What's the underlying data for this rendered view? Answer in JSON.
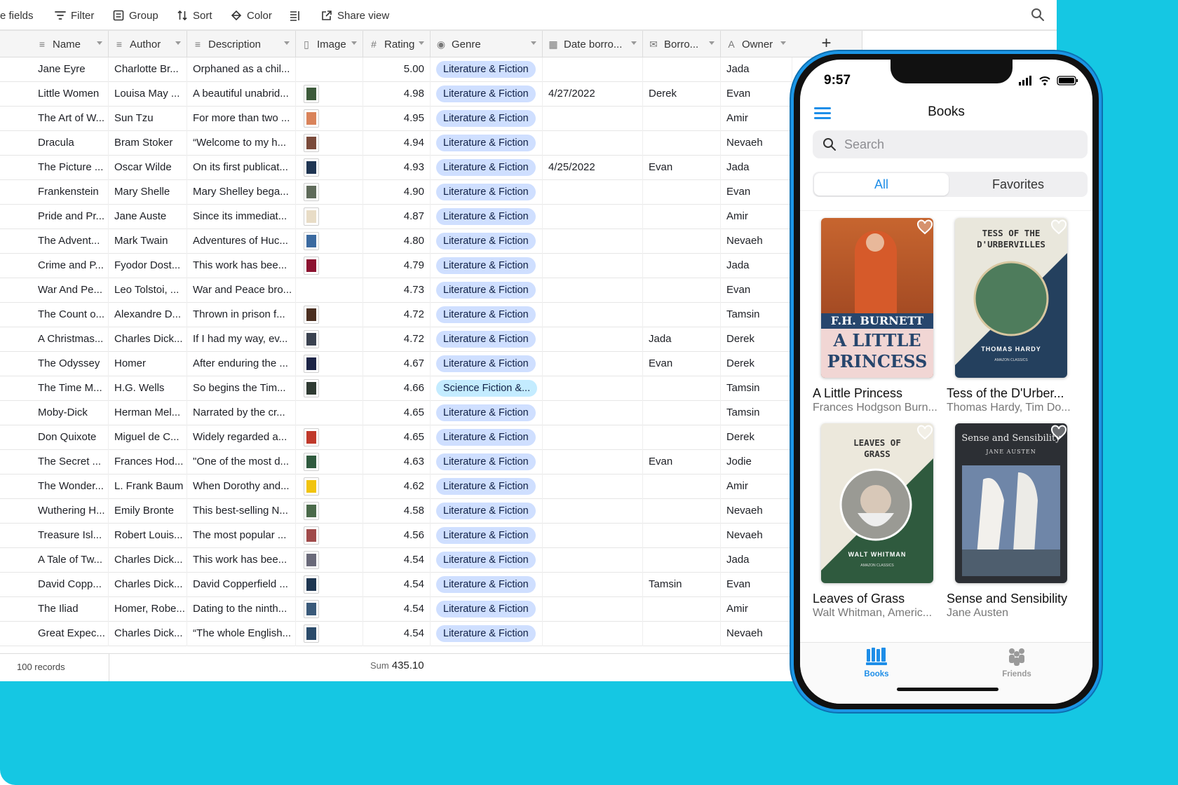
{
  "colors": {
    "teal": "#15c7e3",
    "pill": "#cfdfff",
    "pill_sci": "#c4ecff",
    "ios_blue": "#1e8ee8"
  },
  "toolbar": {
    "hide_fields": "e fields",
    "filter": "Filter",
    "group": "Group",
    "sort": "Sort",
    "color": "Color",
    "share": "Share view"
  },
  "columns": {
    "name": "Name",
    "author": "Author",
    "description": "Description",
    "image": "Image",
    "rating": "Rating",
    "genre": "Genre",
    "date": "Date borro...",
    "borrower": "Borro...",
    "owner": "Owner",
    "add": "+"
  },
  "rows": [
    {
      "name": "Jane Eyre",
      "author": "Charlotte Br...",
      "desc": "Orphaned as a chil...",
      "thumb": "",
      "rating": "5.00",
      "genre": "Literature & Fiction",
      "date": "",
      "borrower": "",
      "owner": "Jada"
    },
    {
      "name": "Little Women",
      "author": "Louisa May ...",
      "desc": "A beautiful unabrid...",
      "thumb": "#3c5a3a",
      "rating": "4.98",
      "genre": "Literature & Fiction",
      "date": "4/27/2022",
      "borrower": "Derek",
      "owner": "Evan"
    },
    {
      "name": "The Art of W...",
      "author": "Sun Tzu",
      "desc": "For more than two ...",
      "thumb": "#d9835a",
      "rating": "4.95",
      "genre": "Literature & Fiction",
      "date": "",
      "borrower": "",
      "owner": "Amir"
    },
    {
      "name": "Dracula",
      "author": "Bram Stoker",
      "desc": "“Welcome to my h...",
      "thumb": "#7a4a3a",
      "rating": "4.94",
      "genre": "Literature & Fiction",
      "date": "",
      "borrower": "",
      "owner": "Nevaeh"
    },
    {
      "name": "The Picture ...",
      "author": "Oscar Wilde",
      "desc": "On its first publicat...",
      "thumb": "#1f3552",
      "rating": "4.93",
      "genre": "Literature & Fiction",
      "date": "4/25/2022",
      "borrower": "Evan",
      "owner": "Jada"
    },
    {
      "name": "Frankenstein",
      "author": "Mary Shelle",
      "desc": "Mary Shelley bega...",
      "thumb": "#5f6b5a",
      "rating": "4.90",
      "genre": "Literature & Fiction",
      "date": "",
      "borrower": "",
      "owner": "Evan"
    },
    {
      "name": "Pride and Pr...",
      "author": "Jane Auste",
      "desc": "Since its immediat...",
      "thumb": "#e8dcc6",
      "rating": "4.87",
      "genre": "Literature & Fiction",
      "date": "",
      "borrower": "",
      "owner": "Amir"
    },
    {
      "name": "The Advent...",
      "author": "Mark Twain",
      "desc": "Adventures of Huc...",
      "thumb": "#3b6aa0",
      "rating": "4.80",
      "genre": "Literature & Fiction",
      "date": "",
      "borrower": "",
      "owner": "Nevaeh"
    },
    {
      "name": "Crime and P...",
      "author": "Fyodor Dost...",
      "desc": "This work has bee...",
      "thumb": "#8c1230",
      "rating": "4.79",
      "genre": "Literature & Fiction",
      "date": "",
      "borrower": "",
      "owner": "Jada"
    },
    {
      "name": "War And Pe...",
      "author": "Leo Tolstoi, ...",
      "desc": "War and Peace bro...",
      "thumb": "",
      "rating": "4.73",
      "genre": "Literature & Fiction",
      "date": "",
      "borrower": "",
      "owner": "Evan"
    },
    {
      "name": "The Count o...",
      "author": "Alexandre D...",
      "desc": "Thrown in prison f...",
      "thumb": "#4a2e20",
      "rating": "4.72",
      "genre": "Literature & Fiction",
      "date": "",
      "borrower": "",
      "owner": "Tamsin"
    },
    {
      "name": "A Christmas...",
      "author": "Charles Dick...",
      "desc": "If I had my way, ev...",
      "thumb": "#3a4250",
      "rating": "4.72",
      "genre": "Literature & Fiction",
      "date": "",
      "borrower": "Jada",
      "owner": "Derek"
    },
    {
      "name": "The Odyssey",
      "author": "Homer",
      "desc": "After enduring the ...",
      "thumb": "#1c2446",
      "rating": "4.67",
      "genre": "Literature & Fiction",
      "date": "",
      "borrower": "Evan",
      "owner": "Derek"
    },
    {
      "name": "The Time M...",
      "author": "H.G. Wells",
      "desc": "So begins the Tim...",
      "thumb": "#2e3a32",
      "rating": "4.66",
      "genre": "Science Fiction &...",
      "date": "",
      "borrower": "",
      "owner": "Tamsin"
    },
    {
      "name": "Moby-Dick",
      "author": "Herman Mel...",
      "desc": "Narrated by the cr...",
      "thumb": "",
      "rating": "4.65",
      "genre": "Literature & Fiction",
      "date": "",
      "borrower": "",
      "owner": "Tamsin"
    },
    {
      "name": "Don Quixote",
      "author": "Miguel de C...",
      "desc": "Widely regarded a...",
      "thumb": "#c0392b",
      "rating": "4.65",
      "genre": "Literature & Fiction",
      "date": "",
      "borrower": "",
      "owner": "Derek"
    },
    {
      "name": "The Secret ...",
      "author": "Frances Hod...",
      "desc": "\"One of the most d...",
      "thumb": "#2f5a3e",
      "rating": "4.63",
      "genre": "Literature & Fiction",
      "date": "",
      "borrower": "Evan",
      "owner": "Jodie"
    },
    {
      "name": "The Wonder...",
      "author": "L. Frank Baum",
      "desc": "When Dorothy and...",
      "thumb": "#f1c40f",
      "rating": "4.62",
      "genre": "Literature & Fiction",
      "date": "",
      "borrower": "",
      "owner": "Amir"
    },
    {
      "name": "Wuthering H...",
      "author": "Emily Bronte",
      "desc": "This best-selling N...",
      "thumb": "#4a6a4a",
      "rating": "4.58",
      "genre": "Literature & Fiction",
      "date": "",
      "borrower": "",
      "owner": "Nevaeh"
    },
    {
      "name": "Treasure Isl...",
      "author": "Robert Louis...",
      "desc": "The most popular ...",
      "thumb": "#a04a4a",
      "rating": "4.56",
      "genre": "Literature & Fiction",
      "date": "",
      "borrower": "",
      "owner": "Nevaeh"
    },
    {
      "name": "A Tale of Tw...",
      "author": "Charles Dick...",
      "desc": "This work has bee...",
      "thumb": "#6a6a7a",
      "rating": "4.54",
      "genre": "Literature & Fiction",
      "date": "",
      "borrower": "",
      "owner": "Jada"
    },
    {
      "name": "David Copp...",
      "author": "Charles Dick...",
      "desc": "David Copperfield ...",
      "thumb": "#1d3550",
      "rating": "4.54",
      "genre": "Literature & Fiction",
      "date": "",
      "borrower": "Tamsin",
      "owner": "Evan"
    },
    {
      "name": "The Iliad",
      "author": "Homer, Robe...",
      "desc": "Dating to the ninth...",
      "thumb": "#3a5a7a",
      "rating": "4.54",
      "genre": "Literature & Fiction",
      "date": "",
      "borrower": "",
      "owner": "Amir"
    },
    {
      "name": "Great Expec...",
      "author": "Charles Dick...",
      "desc": "“The whole English...",
      "thumb": "#2a4a6a",
      "rating": "4.54",
      "genre": "Literature & Fiction",
      "date": "",
      "borrower": "",
      "owner": "Nevaeh"
    }
  ],
  "footer": {
    "records": "100 records",
    "sum_label": "Sum",
    "sum_value": "435.10"
  },
  "phone": {
    "time": "9:57",
    "nav_title": "Books",
    "search_placeholder": "Search",
    "seg_all": "All",
    "seg_favorites": "Favorites",
    "books": [
      {
        "title": "A Little Princess",
        "author": "Frances Hodgson Burn...",
        "cover_line1": "F.H. BURNETT",
        "cover_line2": "A LITTLE",
        "cover_line3": "PRINCESS"
      },
      {
        "title": "Tess of the D'Urber...",
        "author": "Thomas Hardy, Tim Do...",
        "cover_line1": "TESS OF THE",
        "cover_line2": "D'URBERVILLES",
        "cover_line3": "THOMAS HARDY",
        "cover_line4": "AMAZON CLASSICS"
      },
      {
        "title": "Leaves of Grass",
        "author": "Walt Whitman, Americ...",
        "cover_line1": "LEAVES OF",
        "cover_line2": "GRASS",
        "cover_line3": "WALT WHITMAN",
        "cover_line4": "AMAZON CLASSICS"
      },
      {
        "title": "Sense and Sensibility",
        "author": "Jane Austen",
        "cover_line1": "Sense and Sensibility",
        "cover_line2": "JANE AUSTEN"
      }
    ],
    "tab_books": "Books",
    "tab_friends": "Friends"
  }
}
